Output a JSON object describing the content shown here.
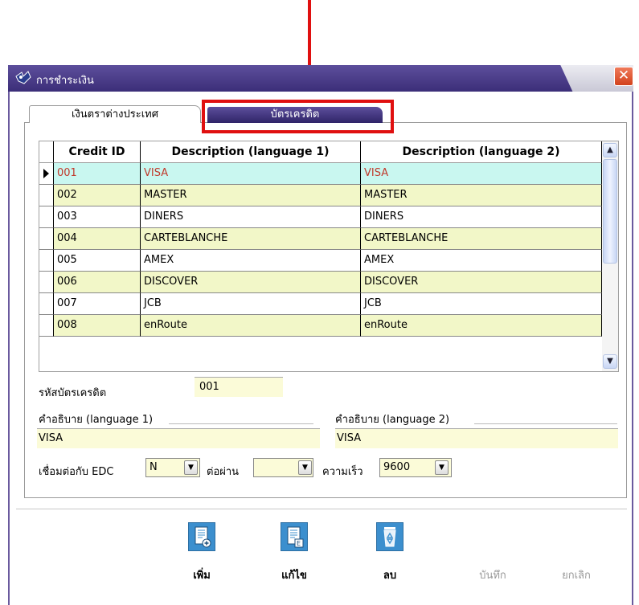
{
  "window": {
    "title": "การชำระเงิน",
    "close_label": "✕"
  },
  "tabs": [
    {
      "label": "เงินตราต่างประเทศ",
      "active": false
    },
    {
      "label": "บัตรเครดิต",
      "active": true
    }
  ],
  "grid": {
    "columns": [
      "Credit ID",
      "Description (language 1)",
      "Description (language 2)"
    ],
    "rows": [
      {
        "id": "001",
        "desc1": "VISA",
        "desc2": "VISA"
      },
      {
        "id": "002",
        "desc1": "MASTER",
        "desc2": "MASTER"
      },
      {
        "id": "003",
        "desc1": "DINERS",
        "desc2": "DINERS"
      },
      {
        "id": "004",
        "desc1": "CARTEBLANCHE",
        "desc2": "CARTEBLANCHE"
      },
      {
        "id": "005",
        "desc1": "AMEX",
        "desc2": "AMEX"
      },
      {
        "id": "006",
        "desc1": "DISCOVER",
        "desc2": "DISCOVER"
      },
      {
        "id": "007",
        "desc1": "JCB",
        "desc2": "JCB"
      },
      {
        "id": "008",
        "desc1": "enRoute",
        "desc2": "enRoute"
      }
    ]
  },
  "form": {
    "card_code_label": "รหัสบัตรเครดิต",
    "card_code_value": "001",
    "desc1_label": "คำอธิบาย (language 1)",
    "desc1_value": "VISA",
    "desc2_label": "คำอธิบาย (language 2)",
    "desc2_value": "VISA",
    "edc_label": "เชื่อมต่อกับ EDC",
    "edc_value": "N",
    "port_label": "ต่อผ่าน",
    "port_value": "",
    "speed_label": "ความเร็ว",
    "speed_value": "9600"
  },
  "toolbar": {
    "add": "เพิ่ม",
    "edit": "แก้ไข",
    "delete": "ลบ",
    "save": "บันทึก",
    "cancel": "ยกเลิก"
  },
  "colors": {
    "title_bar": "#3b2e78",
    "selected_row": "#c9f7f0",
    "alt_row": "#f2f7c8",
    "annotation": "#e01010"
  }
}
